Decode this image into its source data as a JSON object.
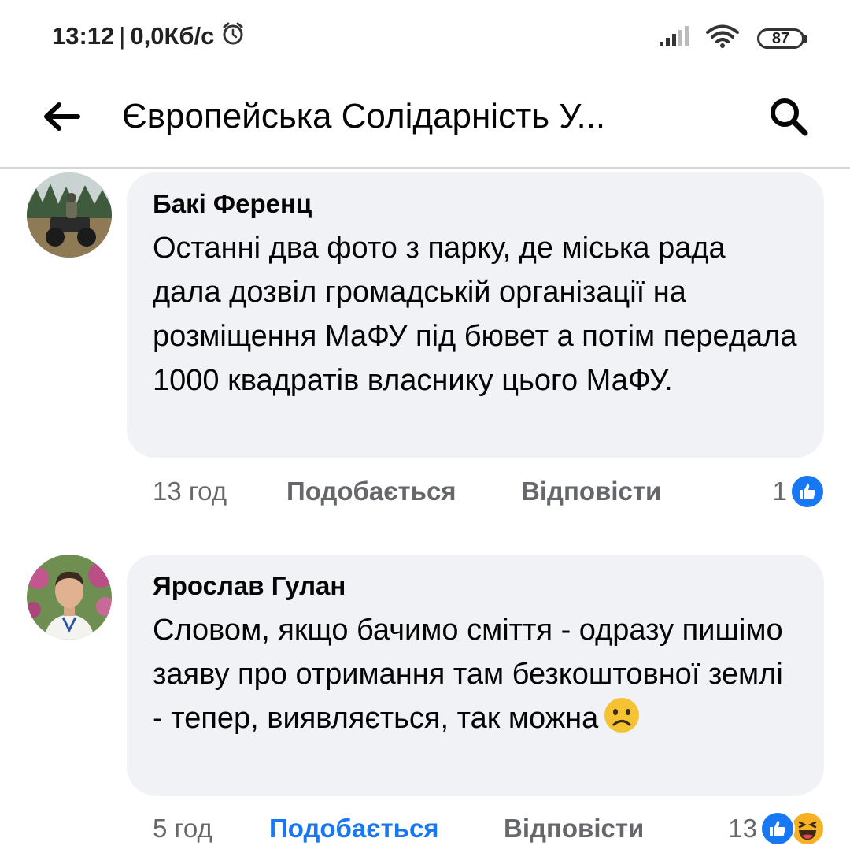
{
  "status_bar": {
    "time": "13:12",
    "separator": "|",
    "network_speed": "0,0Кб/с",
    "alarm_icon": "alarm-clock-icon",
    "signal_icon": "signal-bars-icon",
    "wifi_icon": "wifi-icon",
    "battery_level": "87"
  },
  "header": {
    "back_icon": "arrow-left-icon",
    "title": "Європейська Солідарність У...",
    "search_icon": "search-icon"
  },
  "comments": [
    {
      "author": "Бакі Ференц",
      "text": "Останні два фото з парку, де міська рада дала дозвіл громадській організації на розміщення МаФУ під бювет а потім передала 1000 квадратів власнику цього МаФУ.",
      "time": "13 год",
      "like_label": "Подобається",
      "reply_label": "Відповісти",
      "reaction_count": "1",
      "reactions": [
        "like"
      ],
      "liked_by_me": false
    },
    {
      "author": "Ярослав Гулан",
      "text": "Словом, якщо бачимо сміття - одразу пишімо заяву про отримання там безкоштовної землі - тепер, виявляється, так можна",
      "trailing_emoji": "sad-face-emoji",
      "time": "5 год",
      "like_label": "Подобається",
      "reply_label": "Відповісти",
      "reaction_count": "13",
      "reactions": [
        "like",
        "haha"
      ],
      "liked_by_me": true
    }
  ],
  "colors": {
    "accent": "#1877f2",
    "bubble": "#f0f2f5",
    "meta_text": "#65676b",
    "haha": "#f7b125"
  }
}
